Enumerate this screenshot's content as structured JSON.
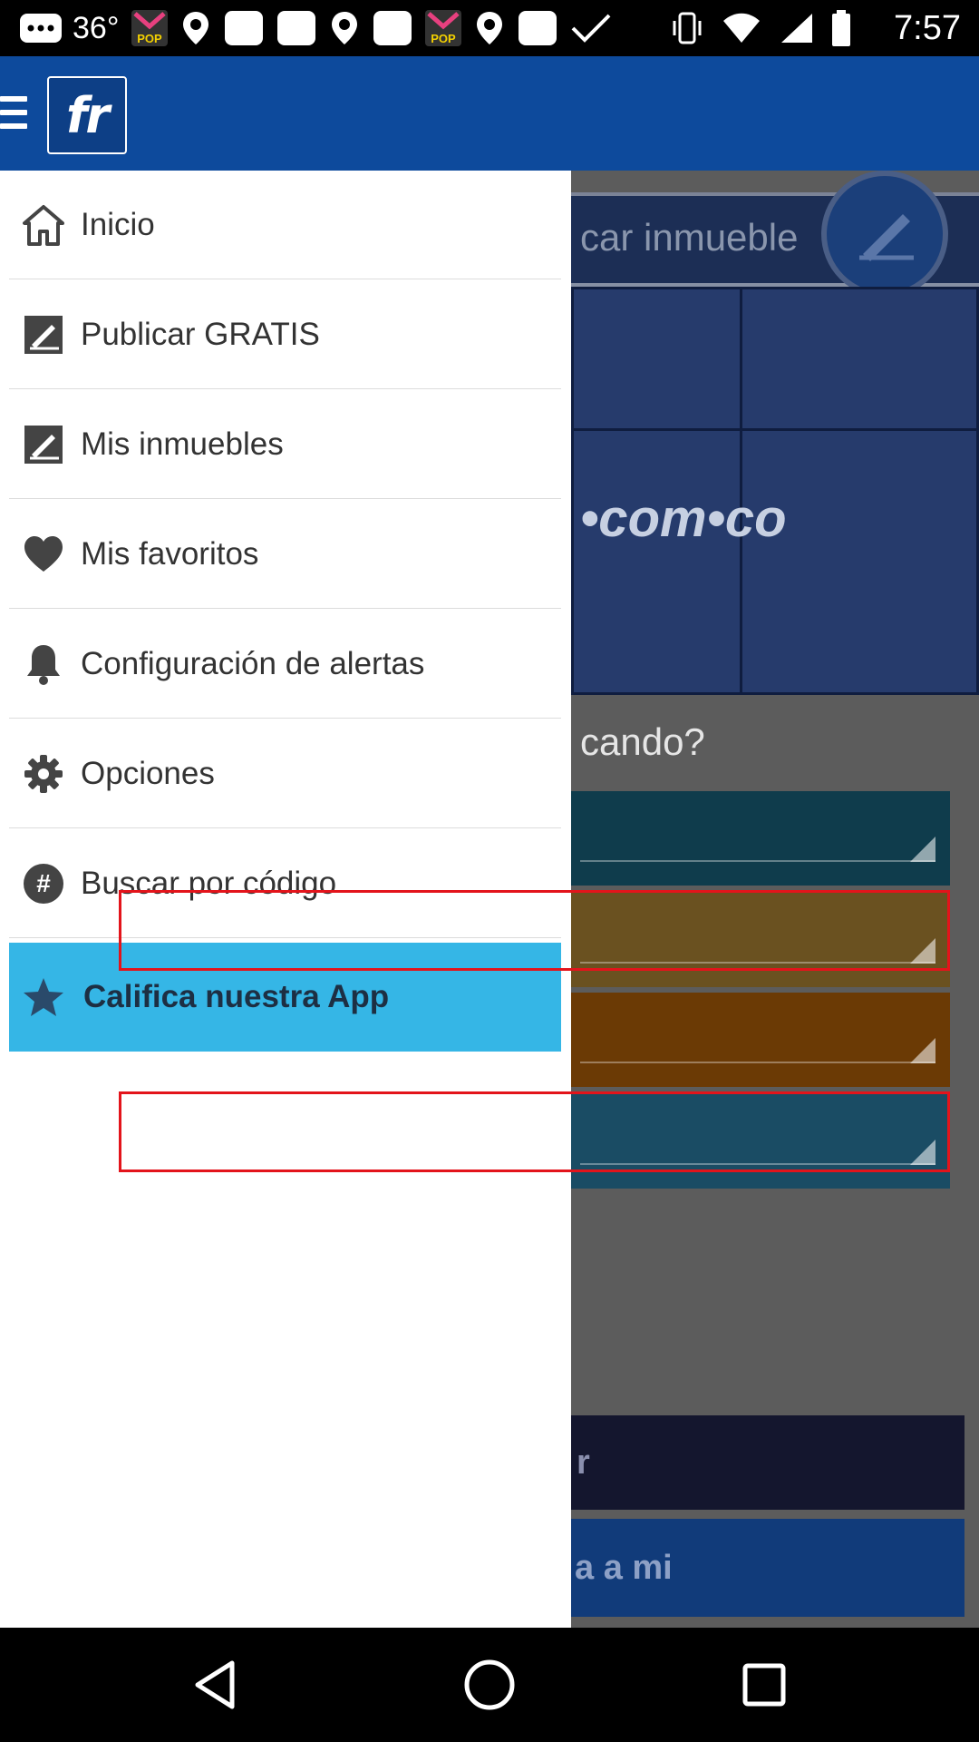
{
  "status_bar": {
    "temperature": "36°",
    "time": "7:57",
    "left_icons": [
      "message-icon",
      "pop-app-icon",
      "location-pin-icon",
      "blank-square-icon",
      "blank-square-icon",
      "location-pin-icon",
      "blank-square-icon",
      "pop-app-icon",
      "location-pin-icon",
      "blank-square-icon",
      "check-icon"
    ],
    "pop_label": "POP"
  },
  "app_bar": {
    "logo_text": "fr",
    "brand_color": "#0d4a9c"
  },
  "background": {
    "search_text": "car inmueble",
    "hero_text": "•com•co",
    "question_text": "cando?",
    "select_colors": [
      "#0f3c4c",
      "#6a5120",
      "#6b3a05",
      "#1a4c64"
    ],
    "button_dark_text": "r",
    "button_blue_text": "a a mi"
  },
  "drawer": {
    "items": [
      {
        "label": "Inicio",
        "icon": "home-icon"
      },
      {
        "label": "Publicar GRATIS",
        "icon": "publish-icon"
      },
      {
        "label": "Mis inmuebles",
        "icon": "publish-icon"
      },
      {
        "label": "Mis favoritos",
        "icon": "heart-icon"
      },
      {
        "label": "Configuración de alertas",
        "icon": "bell-icon"
      },
      {
        "label": "Opciones",
        "icon": "gear-icon"
      },
      {
        "label": "Buscar por código",
        "icon": "hash-icon"
      },
      {
        "label": "Califica nuestra App",
        "icon": "star-icon"
      }
    ],
    "active_color": "#35b6e6"
  },
  "highlight_color": "#e3141b"
}
